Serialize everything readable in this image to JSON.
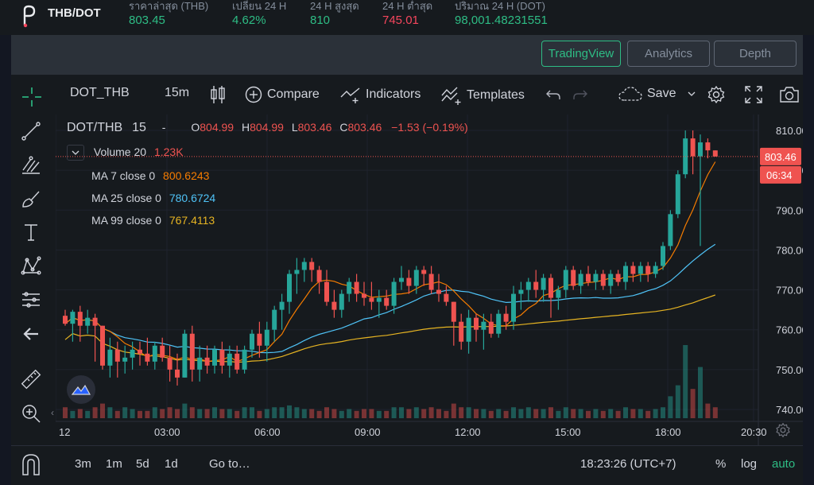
{
  "ticker": {
    "pair": "THB/DOT",
    "stats": [
      {
        "label": "ราคาล่าสุด (THB)",
        "value": "803.45",
        "color": "green"
      },
      {
        "label": "เปลี่ยน 24 H",
        "value": "4.62%",
        "color": "green"
      },
      {
        "label": "24 H สูงสุด",
        "value": "810",
        "color": "green"
      },
      {
        "label": "24 H ต่ำสุด",
        "value": "745.01",
        "color": "red"
      },
      {
        "label": "ปริมาณ 24 H (DOT)",
        "value": "98,001.48231551",
        "color": "green"
      }
    ]
  },
  "view_tabs": [
    {
      "label": "TradingView",
      "active": true
    },
    {
      "label": "Analytics",
      "active": false
    },
    {
      "label": "Depth",
      "active": false
    }
  ],
  "toolbar": {
    "symbol": "DOT_THB",
    "interval": "15m",
    "compare": "Compare",
    "indicators": "Indicators",
    "templates": "Templates",
    "save": "Save"
  },
  "legend": {
    "symbol": "DOT/THB",
    "interval": "15",
    "dash": "-",
    "o_label": "O",
    "o": "804.99",
    "h_label": "H",
    "h": "804.99",
    "l_label": "L",
    "l": "803.46",
    "c_label": "C",
    "c": "803.46",
    "change": "−1.53 (−0.19%)",
    "volume_label": "Volume 20",
    "volume": "1.23K",
    "ma7_label": "MA 7 close 0",
    "ma7": "800.6243",
    "ma25_label": "MA 25 close 0",
    "ma25": "780.6724",
    "ma99_label": "MA 99 close 0",
    "ma99": "767.4113"
  },
  "price_axis": {
    "ticks": [
      "810.00",
      "800.00",
      "790.00",
      "780.00",
      "770.00",
      "760.00",
      "750.00",
      "740.00"
    ],
    "last_price": "803.46",
    "countdown": "06:34"
  },
  "time_axis": {
    "ticks": [
      "12",
      "03:00",
      "06:00",
      "09:00",
      "12:00",
      "15:00",
      "18:00",
      "20:30"
    ]
  },
  "bottom": {
    "ranges": [
      "3m",
      "1m",
      "5d",
      "1d"
    ],
    "goto": "Go to…",
    "clock": "18:23:26 (UTC+7)",
    "percent": "%",
    "log": "log",
    "auto": "auto"
  },
  "colors": {
    "up": "#26a69a",
    "down": "#ef5350",
    "ma7": "#f57c00",
    "ma25": "#4fc3f7",
    "ma99": "#e6b422",
    "accent": "#2ebd85"
  },
  "chart_data": {
    "type": "candlestick",
    "ylim": [
      737,
      814
    ],
    "y_ticks": [
      740,
      750,
      760,
      770,
      780,
      790,
      800,
      810
    ],
    "x_tick_labels": [
      "12",
      "03:00",
      "06:00",
      "09:00",
      "12:00",
      "15:00",
      "18:00",
      "20:30"
    ],
    "bar_interval": "15m",
    "candles": [
      [
        763.5,
        765,
        761,
        761.5,
        3
      ],
      [
        761.5,
        765,
        757,
        764.5,
        2
      ],
      [
        764.5,
        766,
        757,
        761,
        2.5
      ],
      [
        761,
        765,
        759,
        763,
        2
      ],
      [
        763,
        764,
        752,
        761,
        3
      ],
      [
        761,
        761,
        750,
        751,
        4
      ],
      [
        751,
        758,
        748,
        755,
        3
      ],
      [
        755,
        757,
        748,
        752,
        2
      ],
      [
        752,
        756,
        749,
        753,
        3
      ],
      [
        753,
        757,
        750,
        755,
        2.5
      ],
      [
        755,
        757,
        751,
        754,
        2
      ],
      [
        754,
        758,
        751,
        752,
        2
      ],
      [
        752,
        757,
        750,
        756,
        3
      ],
      [
        756,
        758,
        752,
        753,
        2.5
      ],
      [
        753,
        756,
        747,
        750,
        3
      ],
      [
        750,
        754,
        746,
        748,
        2.5
      ],
      [
        748,
        760,
        748,
        759,
        4
      ],
      [
        759,
        761,
        747,
        750,
        3
      ],
      [
        750,
        756,
        747,
        753,
        2.5
      ],
      [
        753,
        756,
        749,
        751,
        2.5
      ],
      [
        751,
        756,
        749,
        755,
        3
      ],
      [
        755,
        757,
        749,
        751,
        2.5
      ],
      [
        751,
        756,
        748,
        754,
        2.5
      ],
      [
        754,
        756,
        749,
        750,
        2
      ],
      [
        750,
        756,
        749,
        755,
        3
      ],
      [
        755,
        760,
        753,
        759,
        3
      ],
      [
        759,
        762,
        753,
        756,
        2
      ],
      [
        756,
        762,
        752,
        760,
        2.5
      ],
      [
        760,
        766,
        757,
        765,
        3
      ],
      [
        765,
        769,
        760,
        767,
        3
      ],
      [
        767,
        775,
        764,
        774,
        3.5
      ],
      [
        774,
        778,
        769,
        775,
        3
      ],
      [
        775,
        778,
        772,
        777,
        2.5
      ],
      [
        777,
        778,
        772,
        775,
        2.5
      ],
      [
        775,
        776,
        769,
        772,
        2
      ],
      [
        772,
        775,
        766,
        767,
        3
      ],
      [
        767,
        770,
        763,
        765,
        2.5
      ],
      [
        765,
        770,
        763,
        769,
        2
      ],
      [
        769,
        773,
        767,
        772,
        2.5
      ],
      [
        772,
        774,
        767,
        769,
        2
      ],
      [
        769,
        772,
        766,
        768,
        2.5
      ],
      [
        768,
        772,
        765,
        767,
        2.5
      ],
      [
        767,
        770,
        763,
        768,
        2
      ],
      [
        768,
        770,
        765,
        766,
        2
      ],
      [
        766,
        773,
        764,
        772,
        3
      ],
      [
        772,
        776,
        770,
        773,
        3
      ],
      [
        773,
        775,
        769,
        771,
        2.5
      ],
      [
        771,
        776,
        769,
        775,
        3
      ],
      [
        775,
        776,
        771,
        774,
        2.5
      ],
      [
        774,
        776,
        769,
        770,
        3
      ],
      [
        770,
        774,
        767,
        769,
        2.5
      ],
      [
        769,
        771,
        766,
        767,
        2
      ],
      [
        767,
        767,
        756,
        762,
        4
      ],
      [
        762,
        764,
        755,
        757,
        3
      ],
      [
        757,
        765,
        754,
        763,
        3
      ],
      [
        763,
        764,
        757,
        760,
        2.5
      ],
      [
        760,
        764,
        755,
        762,
        2.5
      ],
      [
        762,
        764,
        758,
        759,
        2
      ],
      [
        759,
        765,
        758,
        764,
        2.5
      ],
      [
        764,
        766,
        760,
        762,
        2
      ],
      [
        762,
        771,
        760,
        769,
        3
      ],
      [
        769,
        772,
        765,
        770,
        2.5
      ],
      [
        770,
        773,
        767,
        772,
        3
      ],
      [
        772,
        775,
        768,
        770,
        2.5
      ],
      [
        770,
        774,
        767,
        773,
        2.5
      ],
      [
        773,
        774,
        763,
        768,
        3
      ],
      [
        768,
        771,
        765,
        770,
        2
      ],
      [
        770,
        776,
        768,
        775,
        3
      ],
      [
        775,
        776,
        770,
        771,
        2.5
      ],
      [
        771,
        775,
        769,
        774,
        2.5
      ],
      [
        774,
        776,
        771,
        772,
        2
      ],
      [
        772,
        775,
        770,
        774,
        2.5
      ],
      [
        774,
        775,
        770,
        771,
        2
      ],
      [
        771,
        775,
        769,
        774,
        2.5
      ],
      [
        774,
        775,
        771,
        772,
        2
      ],
      [
        772,
        777,
        770,
        776,
        3
      ],
      [
        776,
        777,
        772,
        774,
        2.5
      ],
      [
        774,
        777,
        772,
        776,
        2.5
      ],
      [
        776,
        777,
        772,
        774,
        2
      ],
      [
        774,
        777,
        773,
        776,
        2.5
      ],
      [
        776,
        782,
        775,
        781,
        3
      ],
      [
        781,
        790,
        780,
        789,
        6
      ],
      [
        789,
        800,
        788,
        799,
        9
      ],
      [
        799,
        810,
        798,
        808,
        20
      ],
      [
        808,
        810,
        799,
        803.5,
        8
      ],
      [
        803.5,
        809,
        781,
        807,
        14
      ],
      [
        807,
        808,
        803,
        805,
        4
      ],
      [
        804.99,
        804.99,
        803.46,
        803.46,
        3
      ]
    ]
  }
}
